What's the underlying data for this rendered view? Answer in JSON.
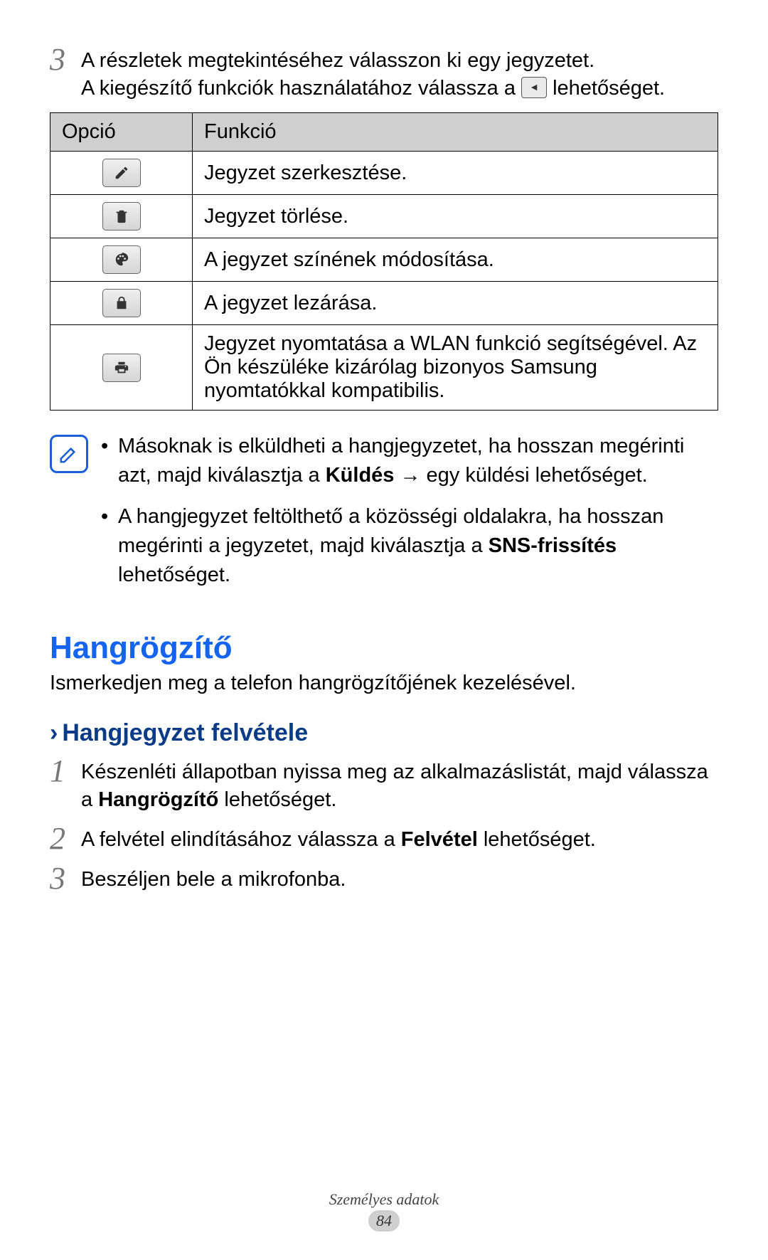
{
  "step3": {
    "num": "3",
    "line1": "A részletek megtekintéséhez válasszon ki egy jegyzetet.",
    "line2a": "A kiegészítő funkciók használatához válassza a ",
    "line2b": " lehetőséget."
  },
  "table": {
    "headers": {
      "opt": "Opció",
      "func": "Funkció"
    },
    "rows": [
      {
        "icon": "edit",
        "func": "Jegyzet szerkesztése."
      },
      {
        "icon": "trash",
        "func": "Jegyzet törlése."
      },
      {
        "icon": "palette",
        "func": "A jegyzet színének módosítása."
      },
      {
        "icon": "lock",
        "func": "A jegyzet lezárása."
      },
      {
        "icon": "print",
        "func": "Jegyzet nyomtatása a WLAN funkció segítségével. Az Ön készüléke kizárólag bizonyos Samsung nyomtatókkal kompatibilis."
      }
    ]
  },
  "notes": {
    "item1_a": "Másoknak is elküldheti a hangjegyzetet, ha hosszan megérinti azt, majd kiválasztja a ",
    "item1_bold": "Küldés",
    "item1_b": " → egy küldési lehetőséget.",
    "item2_a": "A hangjegyzet feltölthető a közösségi oldalakra, ha hosszan megérinti a jegyzetet, majd kiválasztja a ",
    "item2_bold": "SNS-frissítés",
    "item2_b": " lehetőséget."
  },
  "section": {
    "title": "Hangrögzítő",
    "desc": "Ismerkedjen meg a telefon hangrögzítőjének kezelésével."
  },
  "sub": {
    "title": "Hangjegyzet felvétele"
  },
  "steps2": {
    "s1": {
      "num": "1",
      "a": "Készenléti állapotban nyissa meg az alkalmazáslistát, majd válassza a ",
      "bold": "Hangrögzítő",
      "b": " lehetőséget."
    },
    "s2": {
      "num": "2",
      "a": "A felvétel elindításához válassza a ",
      "bold": "Felvétel",
      "b": " lehetőséget."
    },
    "s3": {
      "num": "3",
      "a": "Beszéljen bele a mikrofonba."
    }
  },
  "footer": {
    "title": "Személyes adatok",
    "page": "84"
  }
}
